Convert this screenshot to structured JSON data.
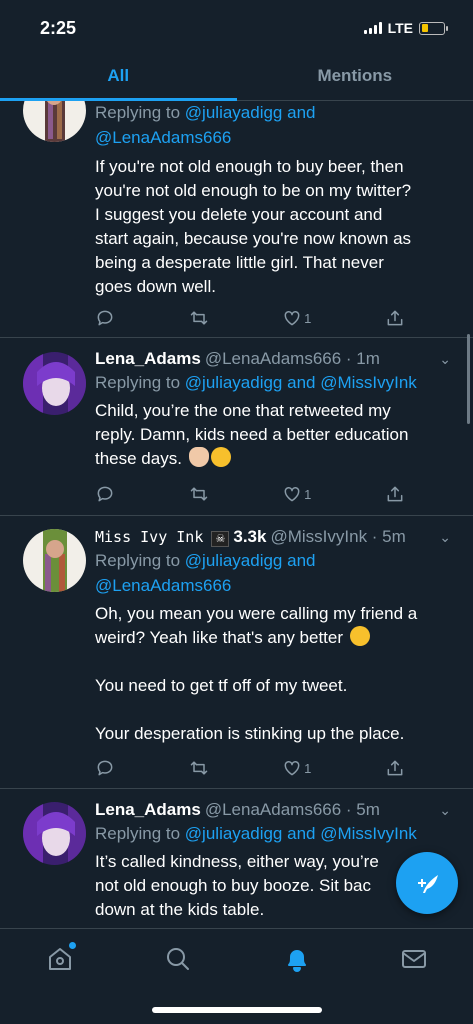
{
  "status_bar": {
    "time": "2:25",
    "network": "LTE",
    "battery_level": 0.3
  },
  "tabs": [
    {
      "label": "All",
      "active": true
    },
    {
      "label": "Mentions",
      "active": false
    }
  ],
  "tweets": [
    {
      "replying_prefix": "Replying to",
      "reply_line1": "@juliayadigg and",
      "reply_line2": "@LenaAdams666",
      "text": "If you're not old enough to buy beer, then\nyou're not old enough to be on my twitter?\nI suggest you delete your account and\nstart again, because you're now known as\nbeing a desperate little girl. That never\ngoes down well.",
      "likes": "1"
    },
    {
      "name": "Lena_Adams",
      "handle": "@LenaAdams666 · 1m",
      "replying_prefix": "Replying to",
      "reply_line1": "@juliayadigg and @MissIvyInk",
      "text": "Child, you’re the one that retweeted my\nreply. Damn, kids need a better education\nthese days.",
      "likes": "1"
    },
    {
      "name": "Miss Ivy Ink",
      "name_suffix": "3.3k",
      "handle": "@MissIvyInk · 5m",
      "replying_prefix": "Replying to",
      "reply_line1": "@juliayadigg and",
      "reply_line2": "@LenaAdams666",
      "text": "Oh, you mean you were calling my friend a\nweird? Yeah like that's any better",
      "text2": "You need to get tf off of my tweet.",
      "text3": "Your desperation is stinking up the place.",
      "likes": "1"
    },
    {
      "name": "Lena_Adams",
      "handle": "@LenaAdams666 · 5m",
      "replying_prefix": "Replying to",
      "reply_line1": "@juliayadigg and @MissIvyInk",
      "text": "It’s called kindness, either way, you’re\nnot old enough to buy booze. Sit bac\ndown at the kids table."
    }
  ],
  "icons": {
    "reply": "reply-icon",
    "retweet": "retweet-icon",
    "like": "heart-icon",
    "share": "share-icon",
    "compose": "compose-icon",
    "home": "home-icon",
    "search": "search-icon",
    "notifications": "bell-icon",
    "messages": "mail-icon"
  },
  "colors": {
    "background": "#15202b",
    "accent": "#1da1f2",
    "muted": "#8899a6",
    "divider": "#38444d"
  }
}
